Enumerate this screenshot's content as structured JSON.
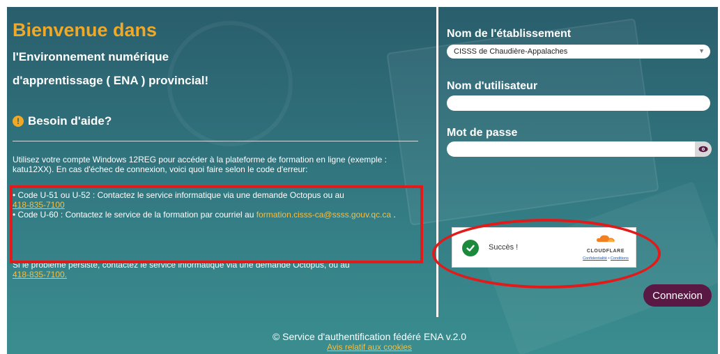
{
  "welcome": {
    "title": "Bienvenue dans",
    "line1": "l'Environnement numérique",
    "line2": "d'apprentissage ( ENA ) provincial!"
  },
  "help": {
    "icon": "exclamation-icon",
    "title": "Besoin d'aide?"
  },
  "instructions": {
    "intro": "Utilisez votre compte Windows 12REG pour accéder à la plateforme de formation en ligne (exemple : katu12XX). En cas d'échec de connexion, voici quoi faire selon le code d'erreur:",
    "code1_text": "• Code U-51 ou U-52 : Contactez le service informatique via une demande Octopus ou au",
    "code1_phone": "418-835-7100",
    "code2_text": "• Code U-60 : Contactez le service de la formation par courriel au",
    "code2_email": "formation.cisss-ca@ssss.gouv.qc.ca",
    "code2_end": " .",
    "persist_text": "Si le problème persiste, contactez le service informatique via une demande Octopus, ou au",
    "persist_phone": "418-835-7100."
  },
  "form": {
    "establishment_label": "Nom de l'établissement",
    "establishment_value": "CISSS de Chaudière-Appalaches",
    "username_label": "Nom d'utilisateur",
    "username_value": "",
    "password_label": "Mot de passe",
    "password_value": "",
    "submit_label": "Connexion"
  },
  "captcha": {
    "status": "Succès !",
    "brand": "CLOUDFLARE",
    "privacy": "Confidentialité",
    "separator": "•",
    "terms": "Conditions"
  },
  "footer": {
    "text": "© Service d'authentification fédéré ENA v.2.0",
    "cookies": "Avis relatif aux cookies"
  },
  "colors": {
    "accent": "#f0a827",
    "link": "#f0c04a",
    "button": "#5a1845",
    "annotation": "#e11a1a"
  }
}
